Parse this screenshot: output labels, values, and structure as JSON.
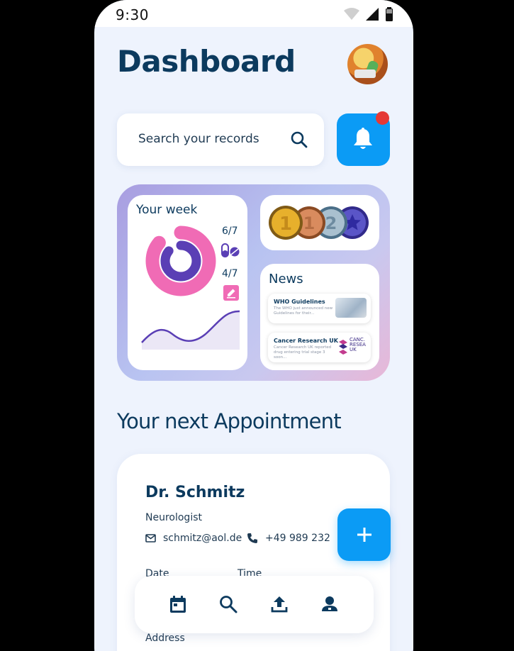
{
  "status_bar": {
    "time": "9:30"
  },
  "header": {
    "title": "Dashboard"
  },
  "search": {
    "placeholder": "Search your records"
  },
  "week_widget": {
    "title": "Your week",
    "medication_stat": "6/7",
    "notes_stat": "4/7",
    "donut_progress_fraction": 0.86
  },
  "news": {
    "title": "News",
    "items": [
      {
        "headline": "WHO Guidelines",
        "snippet": "The WHO just announced new Guidelines for their...",
        "source": ""
      },
      {
        "headline": "Cancer Research UK",
        "snippet": "Cancer Research UK reported drug entering trial stage 3 soon...",
        "source": "CANC. RESEA UK"
      }
    ]
  },
  "appointment": {
    "heading": "Your next Appointment",
    "doctor": "Dr. Schmitz",
    "specialty": "Neurologist",
    "email": "schmitz@aol.de",
    "phone": "+49 989 232",
    "date_label": "Date",
    "time_label": "Time",
    "address_label": "Address"
  },
  "icons": {
    "search": "search-icon",
    "bell": "bell-icon",
    "add": "plus-icon",
    "nav": [
      "calendar-icon",
      "search-icon",
      "upload-icon",
      "profile-icon"
    ]
  },
  "colors": {
    "accent": "#0b9bf5",
    "title": "#0c3a5e",
    "background": "#eef3fd",
    "notification_dot": "#e53935",
    "donut_outer": "#f06bb5",
    "donut_inner": "#5a3fb5"
  }
}
